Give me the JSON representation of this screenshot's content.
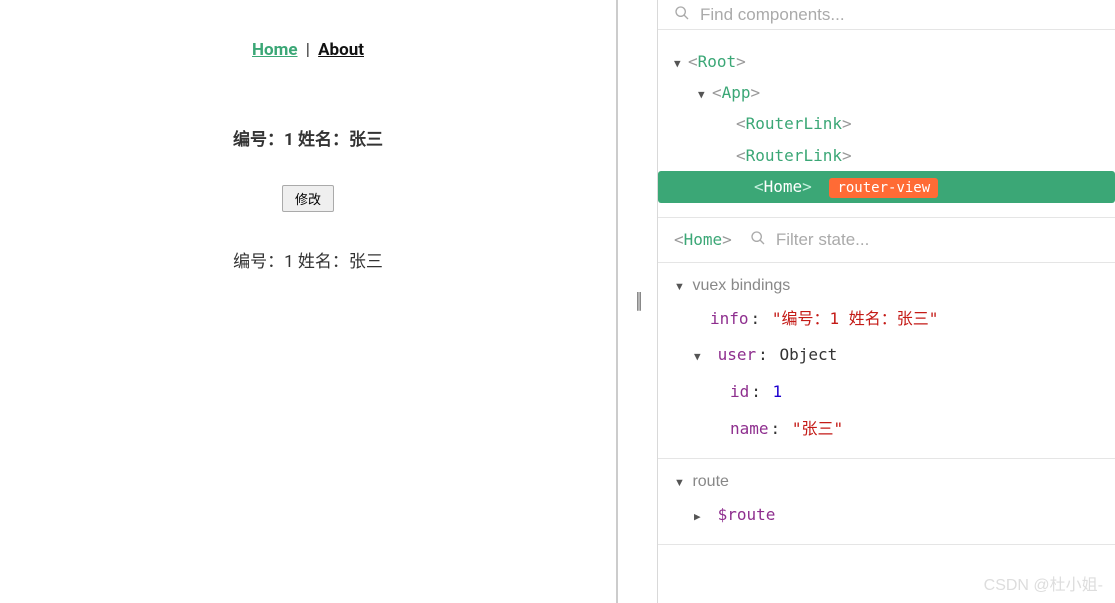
{
  "nav": {
    "home": "Home",
    "sep": "|",
    "about": "About"
  },
  "main": {
    "line1_id_label": "编号：",
    "line1_id_val": "1",
    "line1_name_label": " 姓名：",
    "line1_name_val": "张三",
    "button": "修改",
    "line2_id_label": "编号：",
    "line2_id_val": "1",
    "line2_name_label": " 姓名：",
    "line2_name_val": "张三"
  },
  "devtools": {
    "search_placeholder": "Find components...",
    "tree": {
      "root": "Root",
      "app": "App",
      "rl1": "RouterLink",
      "rl2": "RouterLink",
      "home": "Home",
      "badge": "router-view"
    },
    "state_header": {
      "name": "Home",
      "filter_placeholder": "Filter state..."
    },
    "vuex": {
      "title": "vuex bindings",
      "info_key": "info",
      "info_val": "\"编号：1  姓名：张三\"",
      "user_key": "user",
      "user_type": "Object",
      "id_key": "id",
      "id_val": "1",
      "name_key": "name",
      "name_val": "\"张三\""
    },
    "route": {
      "title": "route",
      "key": "$route"
    }
  },
  "watermark": "CSDN @杜小姐-"
}
